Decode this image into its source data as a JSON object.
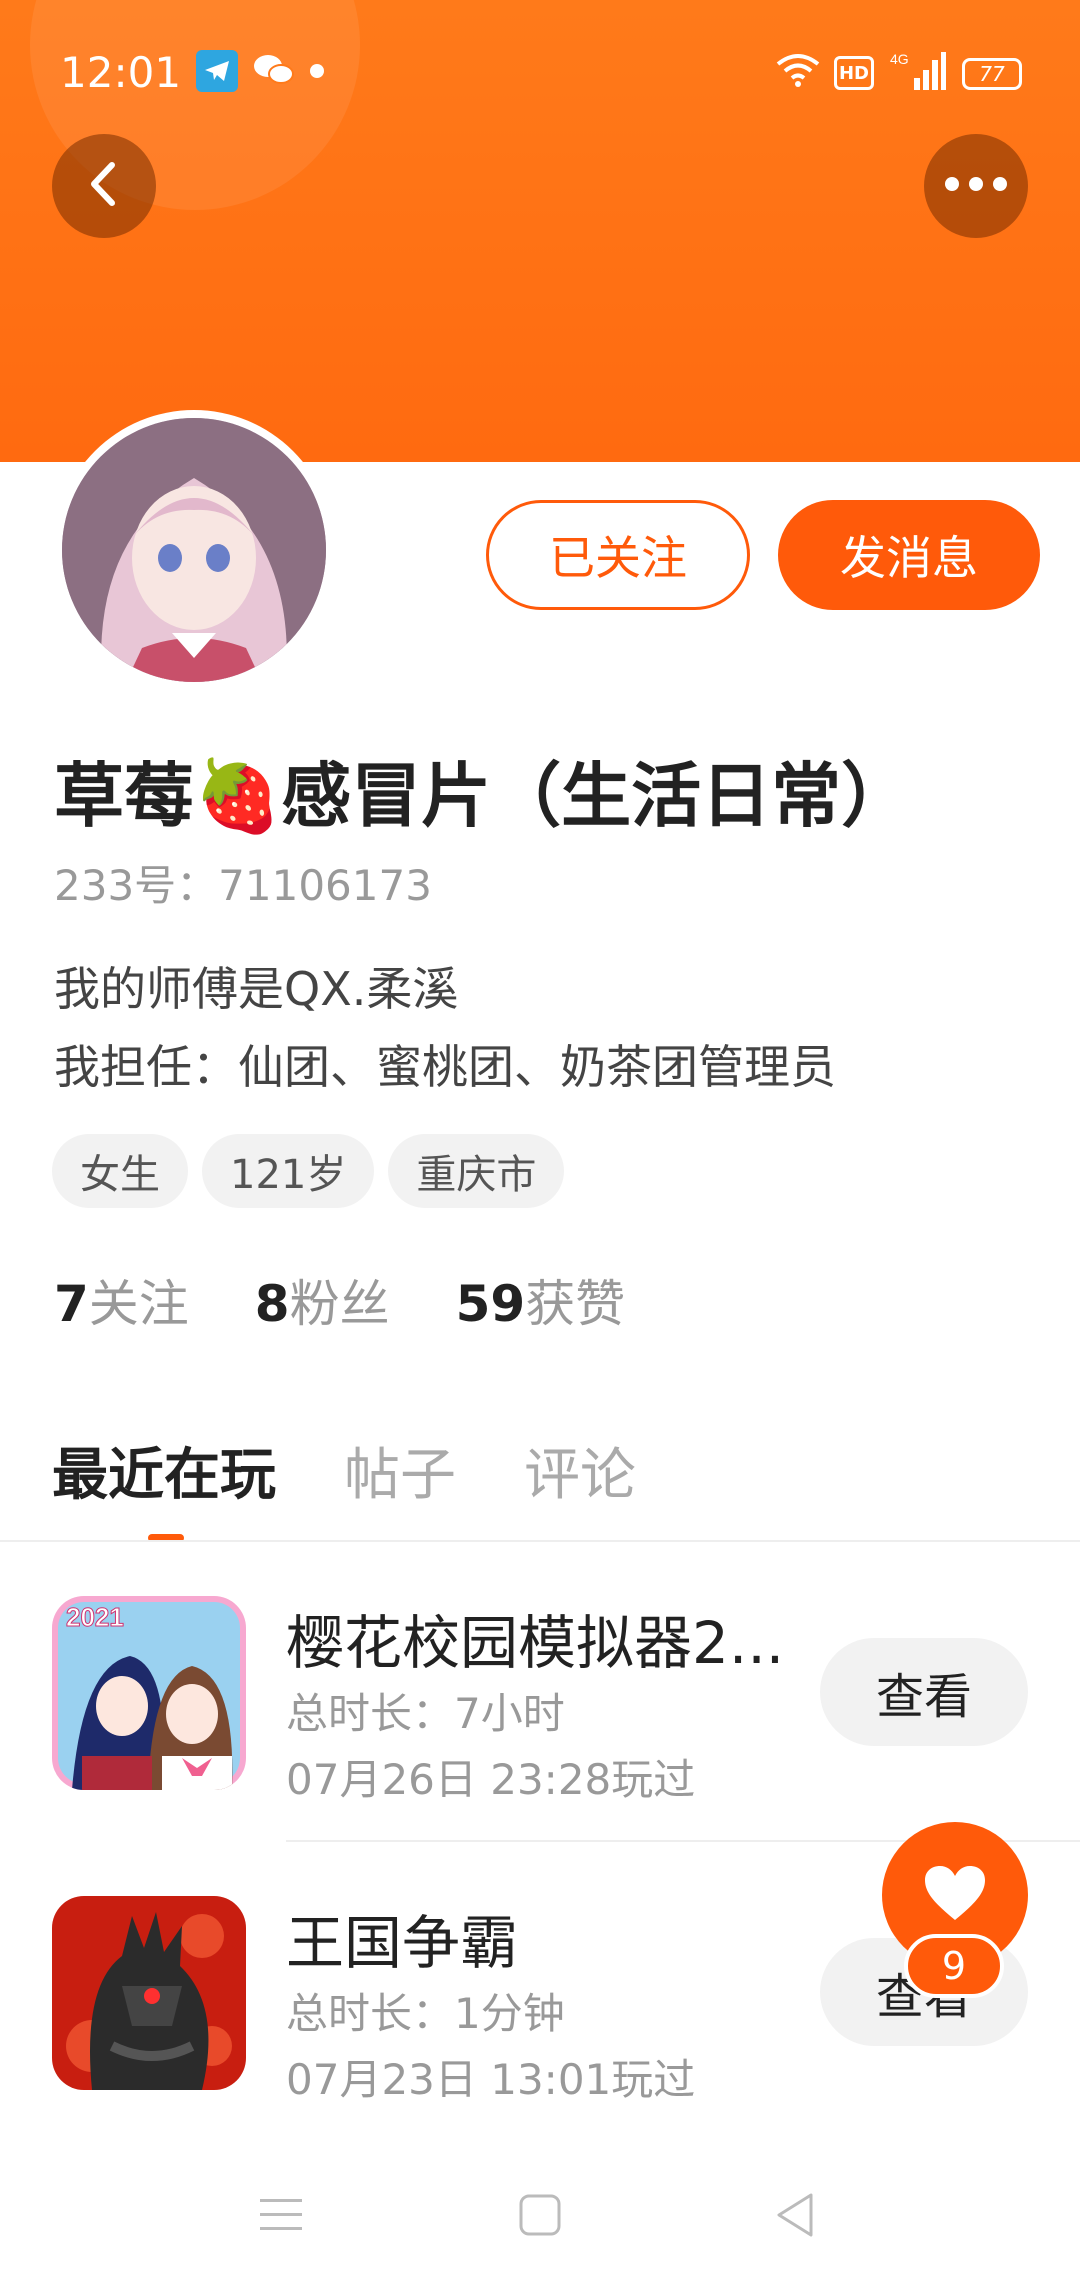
{
  "status_bar": {
    "time": "12:01",
    "battery": "77",
    "network": "4G",
    "hd": "HD"
  },
  "header": {
    "back_icon": "chevron-left-icon",
    "more_icon": "more-icon"
  },
  "profile": {
    "nickname": "草莓🍓感冒片（生活日常）",
    "account_id": "233号：71106173",
    "bio_lines": [
      "我的师傅是QX.柔溪",
      "我担任：仙团、蜜桃团、奶茶团管理员"
    ],
    "tags": [
      "女生",
      "121岁",
      "重庆市"
    ],
    "follow_label": "已关注",
    "message_label": "发消息"
  },
  "stats": {
    "following_num": "7",
    "following_label": "关注",
    "fans_num": "8",
    "fans_label": "粉丝",
    "likes_num": "59",
    "likes_label": "获赞"
  },
  "tabs": [
    "最近在玩",
    "帖子",
    "评论"
  ],
  "games": [
    {
      "title": "樱花校园模拟器2...",
      "duration": "总时长：7小时",
      "played": "07月26日 23:28玩过",
      "button": "查看",
      "icon_badge": "2021"
    },
    {
      "title": "王国争霸",
      "duration": "总时长：1分钟",
      "played": "07月23日 13:01玩过",
      "button": "查看"
    }
  ],
  "like": {
    "count": "9"
  },
  "colors": {
    "accent": "#ff5a0a",
    "banner": "#ff7a1a"
  }
}
